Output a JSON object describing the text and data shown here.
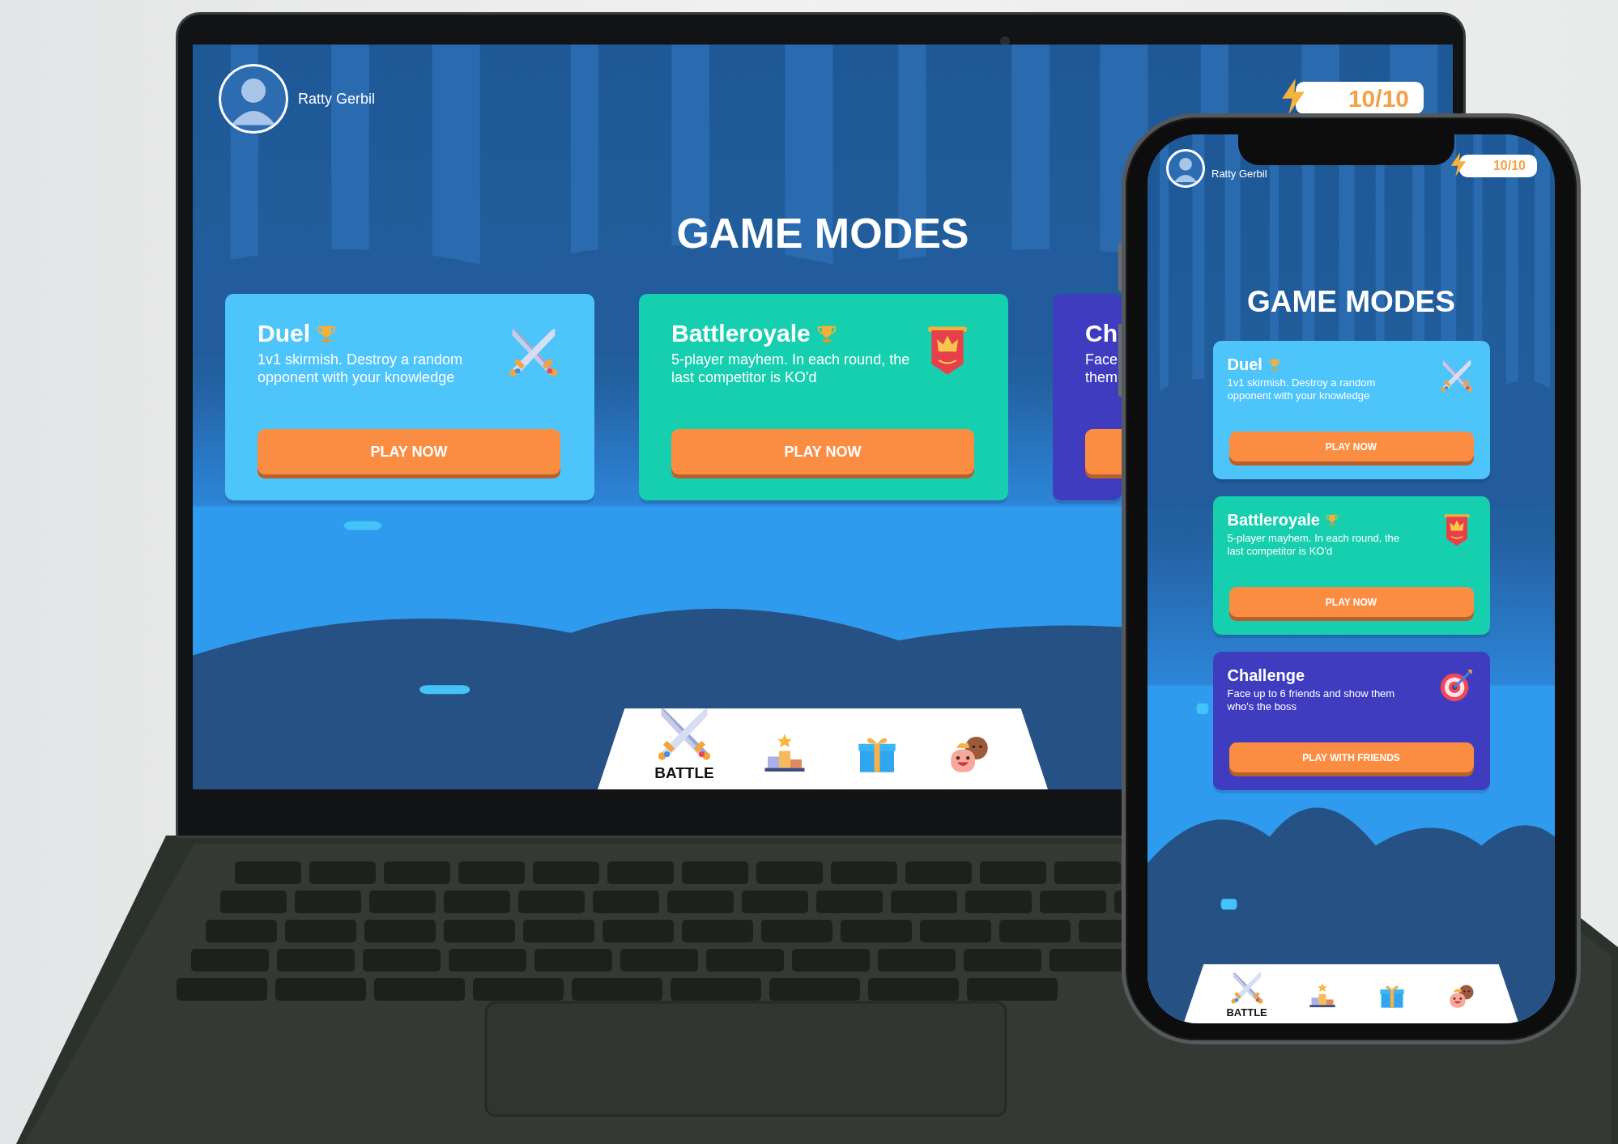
{
  "laptop": {
    "screen": {
      "user": {
        "name": "Ratty Gerbil"
      },
      "energy": "10/10",
      "title": "GAME MODES",
      "modes": [
        {
          "kind": "swords",
          "title": "Duel",
          "trophy": true,
          "description": "1v1 skirmish. Destroy a random opponent with your knowledge",
          "button": "PLAY NOW",
          "color": "#4dc4fa",
          "cut": false
        },
        {
          "kind": "banner",
          "title": "Battleroyale",
          "trophy": true,
          "description": "5-player mayhem. In each round, the last competitor is KO'd",
          "button": "PLAY NOW",
          "color": "#16cfae",
          "cut": false
        },
        {
          "title": "Ch",
          "trophy": false,
          "description": "Face them",
          "color": "#3f3cc0",
          "cut": true
        }
      ],
      "nav": [
        {
          "kind": "swords",
          "label": "BATTLE",
          "selected": true
        },
        {
          "kind": "podium",
          "selected": false
        },
        {
          "kind": "gift",
          "selected": false
        },
        {
          "kind": "friends",
          "selected": false
        }
      ]
    }
  },
  "phone": {
    "screen": {
      "user": {
        "name": "Ratty Gerbil"
      },
      "energy": "10/10",
      "title": "GAME MODES",
      "modes": [
        {
          "kind": "swords",
          "title": "Duel",
          "trophy": true,
          "description": "1v1 skirmish. Destroy a random opponent with your knowledge",
          "button": "PLAY NOW",
          "color": "#4dc4fa",
          "cut": false
        },
        {
          "kind": "banner",
          "title": "Battleroyale",
          "trophy": true,
          "description": "5-player mayhem. In each round, the last competitor is KO'd",
          "button": "PLAY NOW",
          "color": "#16cfae",
          "cut": false
        },
        {
          "kind": "target",
          "title": "Challenge",
          "trophy": false,
          "description": "Face up to 6 friends and show them who's the boss",
          "button": "PLAY WITH FRIENDS",
          "color": "#3f3cc0",
          "cut": false
        }
      ],
      "nav": [
        {
          "kind": "swords",
          "label": "BATTLE",
          "selected": true
        },
        {
          "kind": "podium",
          "selected": false
        },
        {
          "kind": "gift",
          "selected": false
        },
        {
          "kind": "friends",
          "selected": false
        }
      ]
    }
  }
}
